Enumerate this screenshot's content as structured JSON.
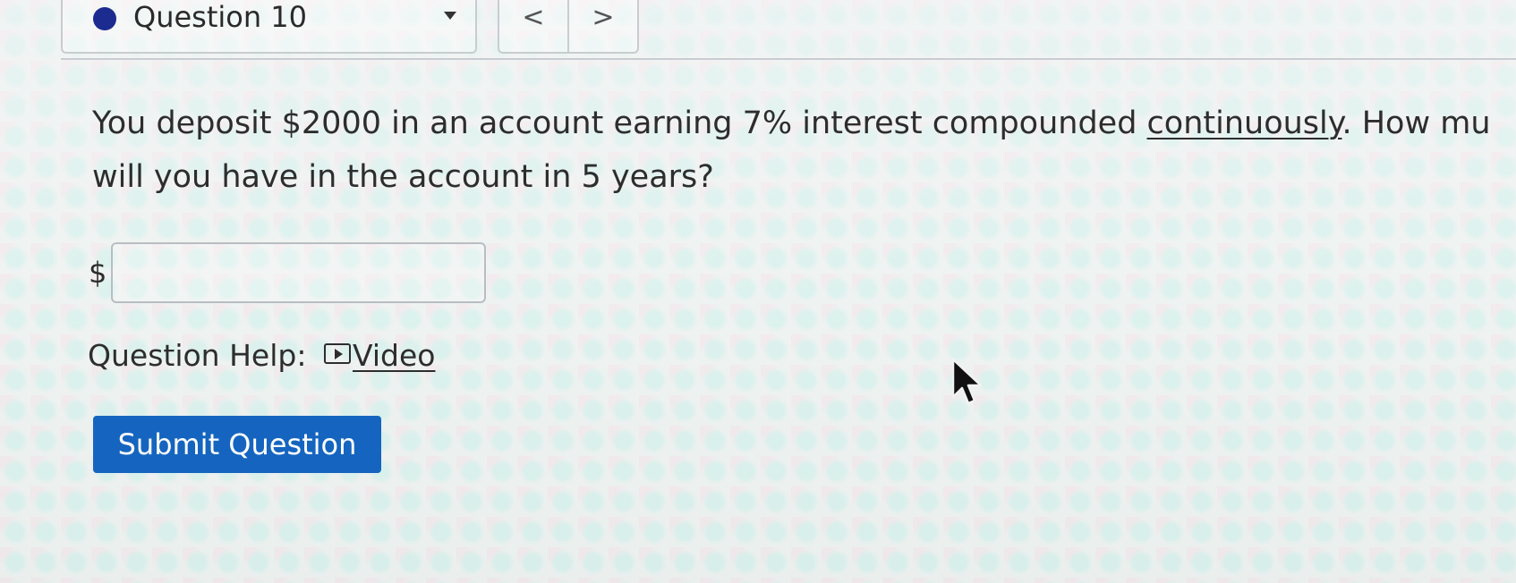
{
  "nav": {
    "question_label": "Question 10",
    "prev_label": "<",
    "next_label": ">"
  },
  "question": {
    "text_part1": "You deposit $2000 in an account earning 7% interest compounded ",
    "emphasis": "continuously",
    "text_part2": ". How mu",
    "text_line2": "will you have in the account in 5 years?"
  },
  "answer": {
    "currency": "$",
    "value": ""
  },
  "help": {
    "label": "Question Help:",
    "video_label": "Video"
  },
  "submit_label": "Submit Question",
  "colors": {
    "status_dot": "#1c2b8f",
    "submit_button": "#1565c0"
  },
  "icons": {
    "status": "filled-circle",
    "dropdown": "caret-down",
    "video": "play-box",
    "cursor": "mouse-pointer"
  }
}
